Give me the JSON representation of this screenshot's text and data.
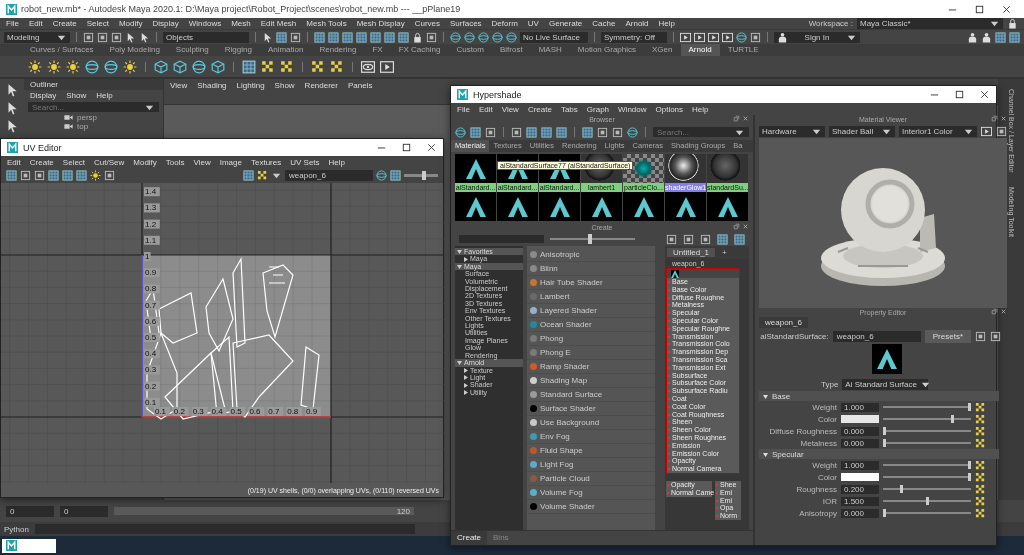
{
  "window": {
    "title": "robot_new.mb* - Autodesk Maya 2020.1: D:\\Maya project\\Robot_Project\\scenes\\robot_new.mb   ---   __pPlane19"
  },
  "menu": [
    "File",
    "Edit",
    "Create",
    "Select",
    "Modify",
    "Display",
    "Windows",
    "Mesh",
    "Edit Mesh",
    "Mesh Tools",
    "Mesh Display",
    "Curves",
    "Surfaces",
    "Deform",
    "UV",
    "Generate",
    "Cache",
    "Arnold",
    "Help"
  ],
  "workspace": {
    "label": "Workspace :",
    "value": "Maya Classic*"
  },
  "status_line": {
    "mode": "Modeling",
    "objects": "Objects",
    "live_surface": "No Live Surface",
    "symmetry": "Symmetry: Off",
    "sign_in": "Sign In"
  },
  "shelf_tabs": [
    {
      "label": "Curves / Surfaces",
      "selected": false
    },
    {
      "label": "Poly Modeling",
      "selected": false
    },
    {
      "label": "Sculpting",
      "selected": false
    },
    {
      "label": "Rigging",
      "selected": false
    },
    {
      "label": "Animation",
      "selected": false
    },
    {
      "label": "Rendering",
      "selected": false
    },
    {
      "label": "FX",
      "selected": false
    },
    {
      "label": "FX Caching",
      "selected": false
    },
    {
      "label": "Custom",
      "selected": false
    },
    {
      "label": "Bifrost",
      "selected": false
    },
    {
      "label": "MASH",
      "selected": false
    },
    {
      "label": "Motion Graphics",
      "selected": false
    },
    {
      "label": "XGen",
      "selected": false
    },
    {
      "label": "Arnold",
      "selected": true
    },
    {
      "label": "TURTLE",
      "selected": false
    }
  ],
  "outliner": {
    "title": "Outliner",
    "menu": [
      "Display",
      "Show",
      "Help"
    ],
    "search_placeholder": "Search...",
    "items": [
      "persp",
      "top"
    ]
  },
  "viewport": {
    "menu": [
      "View",
      "Shading",
      "Lighting",
      "Show",
      "Renderer",
      "Panels"
    ]
  },
  "side_tabs": [
    "Channel Box / Layer Editor",
    "Modeling Toolkit"
  ],
  "uv_editor": {
    "title": "UV Editor",
    "level": 0.6,
    "menu": [
      "Edit",
      "Create",
      "Select",
      "Cut/Sew",
      "Modify",
      "Tools",
      "View",
      "Image",
      "Textures",
      "UV Sets",
      "Help"
    ],
    "uv_set": "weapon_6",
    "axis_labels_v": [
      "1.4",
      "1.3",
      "1.2",
      "1.1",
      "1",
      "0.9",
      "0.8",
      "0.7",
      "0.6",
      "0.5",
      "0.4",
      "0.3",
      "0.2",
      "0.1"
    ],
    "axis_labels_h": [
      "0.1",
      "0.2",
      "0.3",
      "0.4",
      "0.5",
      "0.6",
      "0.7",
      "0.8",
      "0.9"
    ],
    "status": "(0/19) UV shells, (0/0) overlapping UVs, (0/110) reversed UVs"
  },
  "time_slider": {
    "start": "0",
    "current": "0",
    "end": "120",
    "level": 1
  },
  "command_line": {
    "label": "Python"
  },
  "hypershade": {
    "title": "Hypershade",
    "menu": [
      "File",
      "Edit",
      "View",
      "Create",
      "Tabs",
      "Graph",
      "Window",
      "Options",
      "Help"
    ],
    "browser": {
      "title": "Browser",
      "search_placeholder": "Search...",
      "tabs": [
        {
          "label": "Materials",
          "selected": true
        },
        {
          "label": "Textures",
          "selected": false
        },
        {
          "label": "Utilities",
          "selected": false
        },
        {
          "label": "Rendering",
          "selected": false
        },
        {
          "label": "Lights",
          "selected": false
        },
        {
          "label": "Cameras",
          "selected": false
        },
        {
          "label": "Shading Groups",
          "selected": false
        },
        {
          "label": "Ba",
          "selected": false
        }
      ],
      "swatches": [
        {
          "label": "aiStandard...",
          "kind": "arnold",
          "selected": false
        },
        {
          "label": "aiStandard...",
          "kind": "arnold",
          "selected": false
        },
        {
          "label": "aiStandard...",
          "kind": "arnold",
          "selected": false
        },
        {
          "label": "lambert1",
          "kind": "sphere",
          "selected": false
        },
        {
          "label": "particleClo...",
          "kind": "checker",
          "selected": false
        },
        {
          "label": "shaderGlow1",
          "kind": "glow",
          "selected": true
        },
        {
          "label": "standardSu...",
          "kind": "sphere",
          "selected": false
        }
      ],
      "swatches_row_2": [
        {
          "kind": "arnold"
        },
        {
          "kind": "arnold"
        },
        {
          "kind": "arnold"
        },
        {
          "kind": "arnold"
        },
        {
          "kind": "arnold"
        },
        {
          "kind": "arnold"
        },
        {
          "kind": "arnold"
        }
      ],
      "tooltip": "aiStandardSurface77 (aiStandardSurface)"
    },
    "create": {
      "title": "Create",
      "level": 0.45,
      "tree": [
        {
          "label": "Favorites",
          "kind": "group",
          "expanded": true,
          "children": [
            {
              "label": "Maya",
              "kind": "group",
              "expanded": false
            }
          ]
        },
        {
          "label": "Maya",
          "kind": "group",
          "expanded": true,
          "children": [
            {
              "label": "Surface",
              "kind": "leaf"
            },
            {
              "label": "Volumetric",
              "kind": "leaf"
            },
            {
              "label": "Displacement",
              "kind": "leaf"
            },
            {
              "label": "2D Textures",
              "kind": "leaf"
            },
            {
              "label": "3D Textures",
              "kind": "leaf"
            },
            {
              "label": "Env Textures",
              "kind": "leaf"
            },
            {
              "label": "Other Textures",
              "kind": "leaf"
            },
            {
              "label": "Lights",
              "kind": "leaf"
            },
            {
              "label": "Utilities",
              "kind": "leaf"
            },
            {
              "label": "Image Planes",
              "kind": "leaf"
            },
            {
              "label": "Glow",
              "kind": "leaf"
            },
            {
              "label": "Rendering",
              "kind": "leaf"
            }
          ]
        },
        {
          "label": "Arnold",
          "kind": "group",
          "expanded": true,
          "children": [
            {
              "label": "Texture",
              "kind": "group",
              "expanded": false
            },
            {
              "label": "Light",
              "kind": "group",
              "expanded": false
            },
            {
              "label": "Shader",
              "kind": "group",
              "expanded": false
            },
            {
              "label": "Utility",
              "kind": "group",
              "expanded": false
            }
          ]
        }
      ],
      "nodes": [
        {
          "label": "Anisotropic",
          "color": "#8a8a8a"
        },
        {
          "label": "Blinn",
          "color": "#8a8a8a"
        },
        {
          "label": "Hair Tube Shader",
          "color": "#c07830"
        },
        {
          "label": "Lambert",
          "color": "#6a6a6a"
        },
        {
          "label": "Layered Shader",
          "color": "#9ab0c8"
        },
        {
          "label": "Ocean Shader",
          "color": "#1c8c9c"
        },
        {
          "label": "Phong",
          "color": "#7a7a7a"
        },
        {
          "label": "Phong E",
          "color": "#7a7a7a"
        },
        {
          "label": "Ramp Shader",
          "color": "#d05a28"
        },
        {
          "label": "Shading Map",
          "color": "#d0d0d0"
        },
        {
          "label": "Standard Surface",
          "color": "#9a9a9a"
        },
        {
          "label": "Surface Shader",
          "color": "#000000"
        },
        {
          "label": "Use Background",
          "color": "#c8c8c8"
        },
        {
          "label": "Env Fog",
          "color": "#3a9ab8"
        },
        {
          "label": "Fluid Shape",
          "color": "#b85a30"
        },
        {
          "label": "Light Fog",
          "color": "#60a8c8"
        },
        {
          "label": "Particle Cloud",
          "color": "#8a5a40"
        },
        {
          "label": "Volume Fog",
          "color": "#58b0c8"
        },
        {
          "label": "Volume Shader",
          "color": "#000000"
        }
      ],
      "bottom_tabs": [
        {
          "label": "Create",
          "selected": true
        },
        {
          "label": "Bins",
          "selected": false
        }
      ]
    },
    "graph": {
      "tab": "Untitled_1",
      "add_tab": "+",
      "node": {
        "name": "weapon_6",
        "ports": [
          "Base",
          "Base Color",
          "Diffuse Roughne",
          "Metalness",
          "Specular",
          "Specular Color",
          "Specular Roughne",
          "Transmission",
          "Transmission Colo",
          "Transmission Dep",
          "Transmission Sca",
          "Transmission Ext",
          "Subsurface",
          "Subsurface Color",
          "Subsurface Radiu",
          "Coat",
          "Coat Color",
          "Coat Roughness",
          "Sheen",
          "Sheen Color",
          "Sheen Roughnes",
          "Emission",
          "Emission Color",
          "Opacity",
          "Normal Camera"
        ]
      },
      "node_below": [
        "Opacity",
        "Normal Came"
      ],
      "node_side": [
        "Shee",
        "Emi",
        "Emi",
        "Opa",
        "Norm"
      ]
    },
    "material_viewer": {
      "title": "Material Viewer",
      "renderer": "Hardware",
      "geometry": "Shader Ball",
      "environment": "Interior1 Color"
    },
    "property_editor": {
      "title": "Property Editor",
      "tab": "weapon_6",
      "type_label": "aiStandardSurface:",
      "name": "weapon_6",
      "presets": "Presets*",
      "shader_type_label": "Type",
      "shader_type": "Ai Standard Surface",
      "sections": [
        {
          "title": "Base",
          "expanded": true,
          "rows": [
            {
              "label": "Weight",
              "kind": "number",
              "value": "1.000",
              "level": 1
            },
            {
              "label": "Color",
              "kind": "color",
              "color": "#e6e6e6",
              "level": 0.8
            },
            {
              "label": "Diffuse Roughness",
              "kind": "number",
              "value": "0.000",
              "level": 0
            },
            {
              "label": "Metalness",
              "kind": "number",
              "value": "0.000",
              "level": 0
            }
          ]
        },
        {
          "title": "Specular",
          "expanded": true,
          "rows": [
            {
              "label": "Weight",
              "kind": "number",
              "value": "1.000",
              "level": 1
            },
            {
              "label": "Color",
              "kind": "color",
              "color": "#ffffff",
              "level": 1
            },
            {
              "label": "Roughness",
              "kind": "number",
              "value": "0.200",
              "level": 0.2
            },
            {
              "label": "IOR",
              "kind": "number",
              "value": "1.500",
              "level": 0.5
            },
            {
              "label": "Anisotropy",
              "kind": "number",
              "value": "0.000",
              "level": 0
            }
          ]
        }
      ]
    }
  }
}
